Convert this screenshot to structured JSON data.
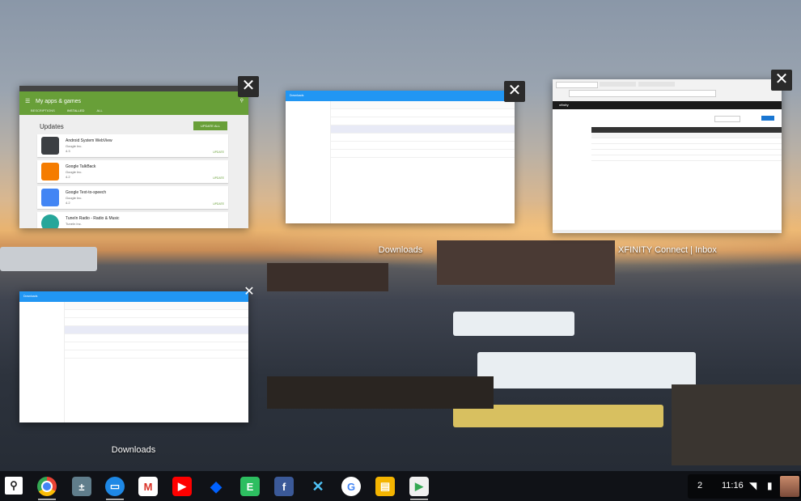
{
  "windows": {
    "play_store": {
      "title": "My apps & games",
      "tabs": [
        "BESCRIPTIONS",
        "INSTALLED",
        "ALL"
      ],
      "updates_heading": "Updates",
      "update_all": "UPDATE ALL",
      "apps": [
        {
          "name": "Android System WebView",
          "publisher": "Google Inc.",
          "rating": "4.3",
          "action": "UPDATE",
          "color": "#3c3f43"
        },
        {
          "name": "Google TalkBack",
          "publisher": "Google Inc.",
          "rating": "4.2",
          "action": "UPDATE",
          "color": "#f57c00"
        },
        {
          "name": "Google Text-to-speech",
          "publisher": "Google Inc.",
          "rating": "4.2",
          "action": "UPDATE",
          "color": "#4285f4"
        },
        {
          "name": "TuneIn Radio - Radio & Music",
          "publisher": "TuneIn Inc.",
          "rating": "",
          "action": "",
          "color": "#26a69a"
        }
      ]
    },
    "downloads_top": {
      "caption": "Downloads",
      "title": "Downloads"
    },
    "xfinity": {
      "caption": "XFINITY Connect | Inbox",
      "logo": "xfinity"
    },
    "downloads_bottom": {
      "caption": "Downloads",
      "title": "Downloads"
    }
  },
  "shelf": {
    "apps": [
      {
        "name": "Chrome",
        "color": "#e8eaed"
      },
      {
        "name": "Calculator",
        "color": "#607d8b"
      },
      {
        "name": "Files",
        "color": "#1e88e5"
      },
      {
        "name": "Gmail",
        "color": "#ffffff"
      },
      {
        "name": "YouTube",
        "color": "#ff0000"
      },
      {
        "name": "Dropbox",
        "color": "#0061ff"
      },
      {
        "name": "Evernote",
        "color": "#2dbe60"
      },
      {
        "name": "Facebook",
        "color": "#3b5998"
      },
      {
        "name": "Tweetbot",
        "color": "#2196f3"
      },
      {
        "name": "Google",
        "color": "#ffffff"
      },
      {
        "name": "Slides",
        "color": "#f4b400"
      },
      {
        "name": "Play Store",
        "color": "#f0f0f0"
      }
    ]
  },
  "tray": {
    "notifications": "2",
    "time": "11:16"
  }
}
